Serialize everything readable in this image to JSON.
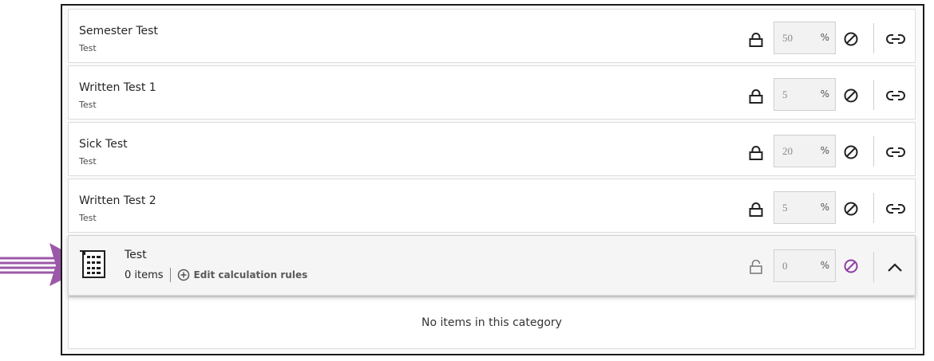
{
  "rows": [
    {
      "title": "Semester Test",
      "type": "Test",
      "weight": "50",
      "percent": "%"
    },
    {
      "title": "Written Test 1",
      "type": "Test",
      "weight": "5",
      "percent": "%"
    },
    {
      "title": "Sick Test",
      "type": "Test",
      "weight": "20",
      "percent": "%"
    },
    {
      "title": "Written Test 2",
      "type": "Test",
      "weight": "5",
      "percent": "%"
    }
  ],
  "category": {
    "title": "Test",
    "items": "0 items",
    "edit_label": "Edit calculation rules",
    "weight": "0",
    "percent": "%"
  },
  "empty_message": "No items in this category",
  "icons": {
    "row": [
      "lock-icon",
      "no-entry-icon",
      "link-icon"
    ],
    "category": [
      "calculator-icon",
      "unlock-icon",
      "no-entry-icon",
      "chevron-up-icon",
      "plus-circle-icon"
    ],
    "annotation": "arrow-icon"
  },
  "colors": {
    "accent": "#8f3fa3",
    "arrow": "#9b58a8"
  }
}
